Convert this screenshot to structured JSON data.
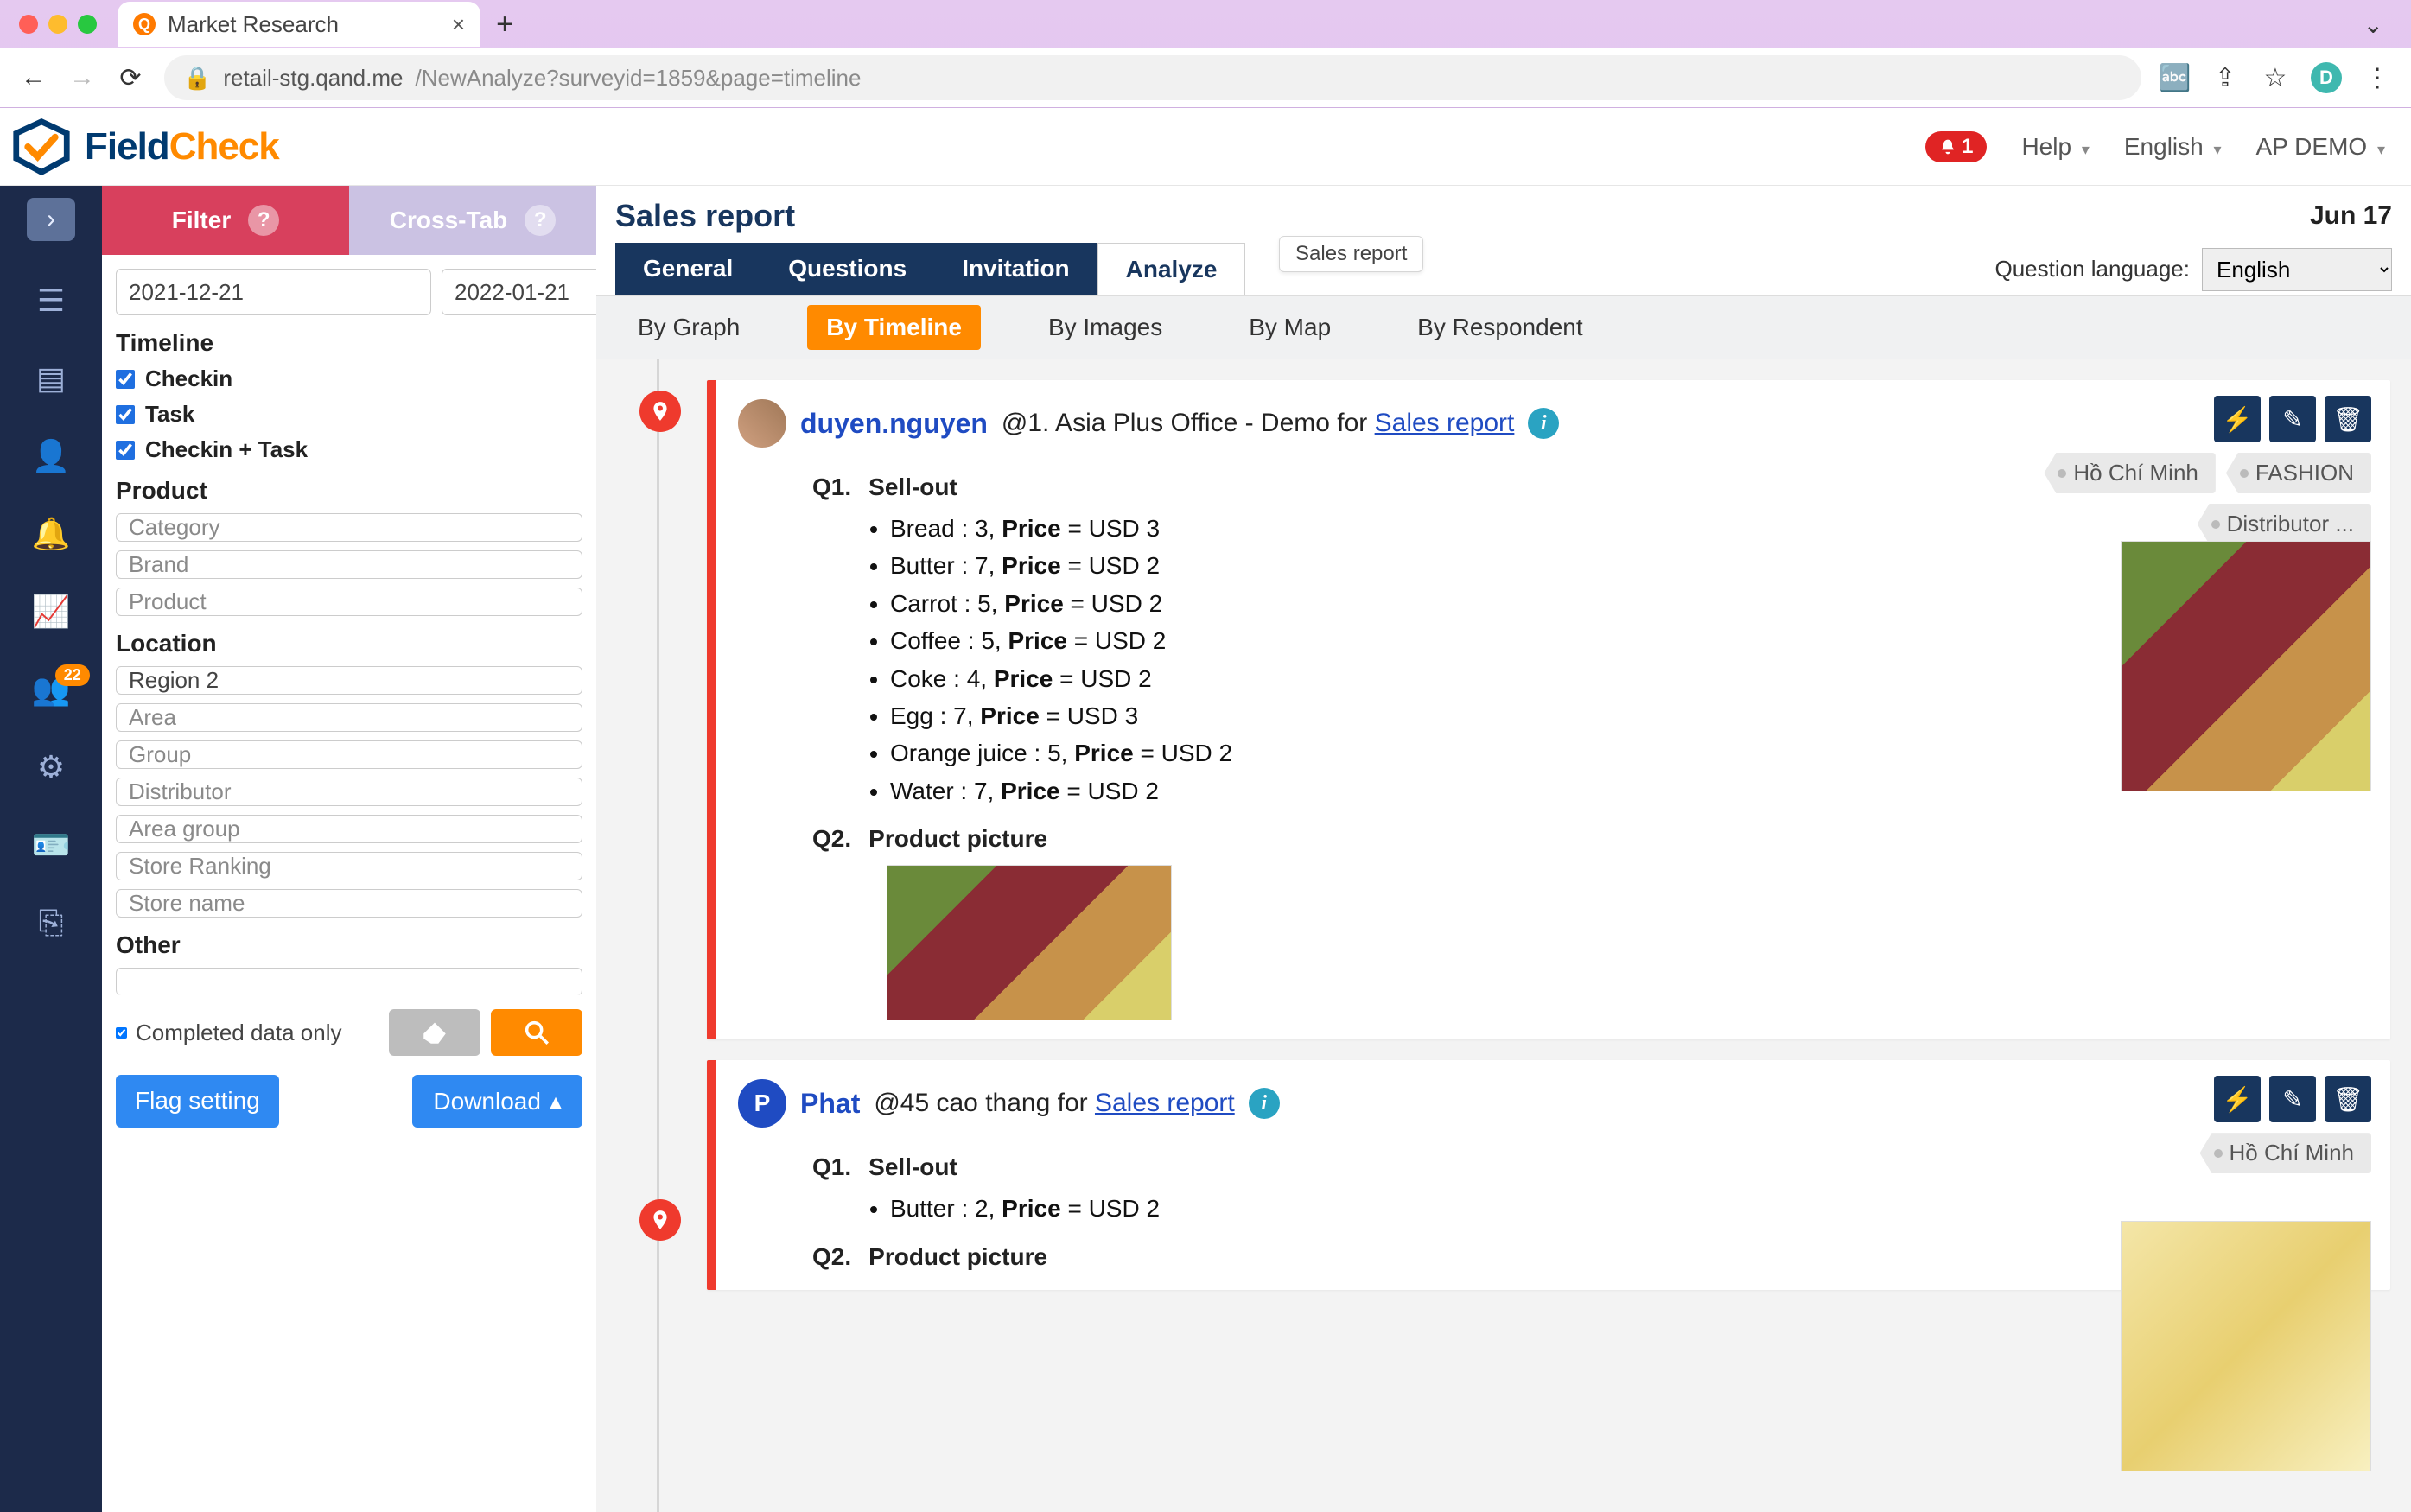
{
  "browser": {
    "tab_title": "Market Research",
    "url_host": "retail-stg.qand.me",
    "url_path": "/NewAnalyze?surveyid=1859&page=timeline"
  },
  "header": {
    "brand1": "Field",
    "brand2": "Check",
    "notif_count": "1",
    "help": "Help",
    "lang": "English",
    "user": "AP DEMO"
  },
  "rail": {
    "badge": "22"
  },
  "filter": {
    "tab_filter": "Filter",
    "tab_cross": "Cross-Tab",
    "date_from": "2021-12-21",
    "date_to": "2022-01-21",
    "h_timeline": "Timeline",
    "chk_checkin": "Checkin",
    "chk_task": "Task",
    "chk_checkin_task": "Checkin + Task",
    "h_product": "Product",
    "ph_category": "Category",
    "ph_brand": "Brand",
    "ph_product": "Product",
    "h_location": "Location",
    "v_region": "Region 2",
    "ph_area": "Area",
    "ph_group": "Group",
    "ph_distributor": "Distributor",
    "ph_areagroup": "Area group",
    "ph_ranking": "Store Ranking",
    "ph_storename": "Store name",
    "h_other": "Other",
    "completed": "Completed data only",
    "btn_flag": "Flag setting",
    "btn_download": "Download"
  },
  "main": {
    "title": "Sales report",
    "date_label": "Jun 17",
    "tooltip": "Sales report",
    "tab_general": "General",
    "tab_questions": "Questions",
    "tab_invitation": "Invitation",
    "tab_analyze": "Analyze",
    "lang_label": "Question language:",
    "lang_value": "English",
    "sub_graph": "By Graph",
    "sub_timeline": "By Timeline",
    "sub_images": "By Images",
    "sub_map": "By Map",
    "sub_respondent": "By Respondent"
  },
  "cards": [
    {
      "user": "duyen.nguyen",
      "loc_prefix": "@1. Asia Plus Office - Demo for ",
      "rep": "Sales report",
      "tags": [
        "Hồ Chí Minh",
        "FASHION",
        "Distributor ..."
      ],
      "q1": "Q1.",
      "q1_t": "Sell-out",
      "q2": "Q2.",
      "q2_t": "Product picture",
      "items": [
        {
          "n": "Bread",
          "q": "3",
          "p": "USD 3"
        },
        {
          "n": "Butter",
          "q": "7",
          "p": "USD 2"
        },
        {
          "n": "Carrot",
          "q": "5",
          "p": "USD 2"
        },
        {
          "n": "Coffee",
          "q": "5",
          "p": "USD 2"
        },
        {
          "n": "Coke",
          "q": "4",
          "p": "USD 2"
        },
        {
          "n": "Egg",
          "q": "7",
          "p": "USD 3"
        },
        {
          "n": "Orange juice",
          "q": "5",
          "p": "USD 2"
        },
        {
          "n": "Water",
          "q": "7",
          "p": "USD 2"
        }
      ]
    },
    {
      "user": "Phat",
      "avatar_letter": "P",
      "loc_prefix": "@45 cao thang for ",
      "rep": "Sales report",
      "tags": [
        "Hồ Chí Minh"
      ],
      "q1": "Q1.",
      "q1_t": "Sell-out",
      "q2": "Q2.",
      "q2_t": "Product picture",
      "items": [
        {
          "n": "Butter",
          "q": "2",
          "p": "USD 2"
        }
      ]
    }
  ]
}
